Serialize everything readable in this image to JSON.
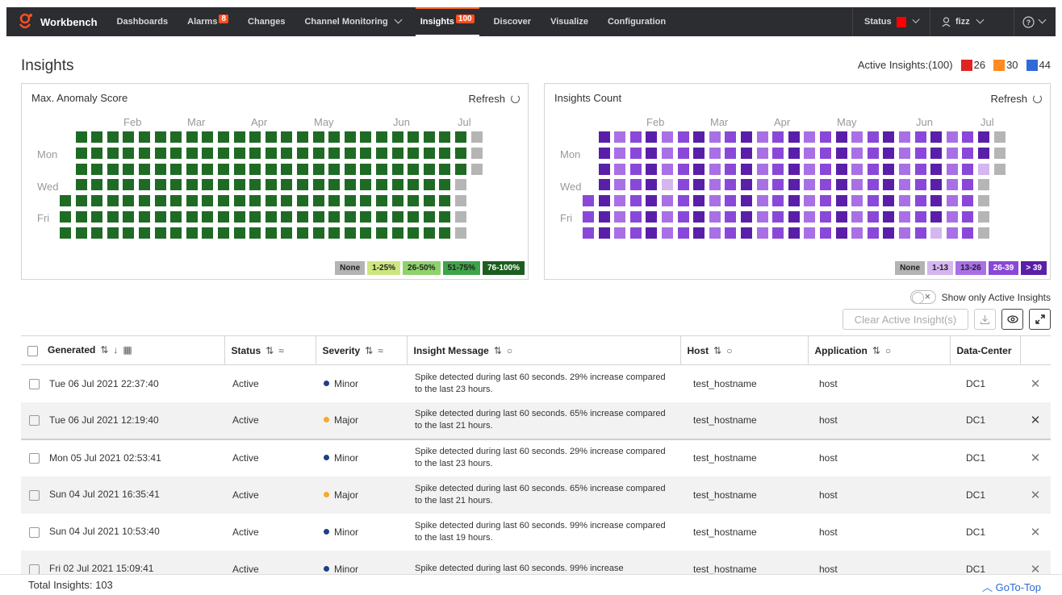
{
  "nav": {
    "brand": "Workbench",
    "items": [
      {
        "label": "Dashboards",
        "badge": "",
        "dropdown": false,
        "active": false
      },
      {
        "label": "Alarms",
        "badge": "8",
        "dropdown": false,
        "active": false
      },
      {
        "label": "Changes",
        "badge": "",
        "dropdown": false,
        "active": false
      },
      {
        "label": "Channel Monitoring",
        "badge": "",
        "dropdown": true,
        "active": false
      },
      {
        "label": "Insights",
        "badge": "100",
        "dropdown": false,
        "active": true
      },
      {
        "label": "Discover",
        "badge": "",
        "dropdown": false,
        "active": false
      },
      {
        "label": "Visualize",
        "badge": "",
        "dropdown": false,
        "active": false
      },
      {
        "label": "Configuration",
        "badge": "",
        "dropdown": false,
        "active": false
      }
    ],
    "status_label": "Status",
    "status_color": "#ff0000",
    "user": "fizz",
    "help_icon": "help-circle-icon"
  },
  "page": {
    "title": "Insights",
    "active_insights_label": "Active Insights:(100)",
    "counts": [
      {
        "value": "26",
        "color": "#e02424"
      },
      {
        "value": "30",
        "color": "#ff8a1f"
      },
      {
        "value": "44",
        "color": "#2f6bd6"
      }
    ]
  },
  "anomaly_panel": {
    "title": "Max. Anomaly Score",
    "refresh": "Refresh",
    "months": [
      "Feb",
      "Mar",
      "Apr",
      "May",
      "Jun",
      "Jul"
    ],
    "days": [
      "Mon",
      "Wed",
      "Fri"
    ],
    "legend": [
      {
        "label": "None",
        "bg": "#b3b3b3"
      },
      {
        "label": "1-25%",
        "bg": "#cde680"
      },
      {
        "label": "26-50%",
        "bg": "#8fd16b"
      },
      {
        "label": "51-75%",
        "bg": "#3fa34a"
      },
      {
        "label": "76-100%",
        "bg": "#1c5e20"
      }
    ],
    "cell_color": "#1f6b25",
    "none_color": "#b5b5b5"
  },
  "count_panel": {
    "title": "Insights Count",
    "refresh": "Refresh",
    "months": [
      "Feb",
      "Mar",
      "Apr",
      "May",
      "Jun",
      "Jul"
    ],
    "days": [
      "Mon",
      "Wed",
      "Fri"
    ],
    "legend": [
      {
        "label": "None",
        "bg": "#b3b3b3"
      },
      {
        "label": "1-13",
        "bg": "#d5b6ef"
      },
      {
        "label": "13-26",
        "bg": "#a970e6"
      },
      {
        "label": "26-39",
        "bg": "#8a48d8"
      },
      {
        "label": "> 39",
        "bg": "#5a1fa8"
      }
    ]
  },
  "controls": {
    "toggle_label": "Show only Active Insights",
    "clear_button": "Clear Active Insight(s)"
  },
  "table": {
    "columns": [
      "Generated",
      "Status",
      "Severity",
      "Insight Message",
      "Host",
      "Application",
      "Data-Center"
    ],
    "rows": [
      {
        "generated": "Tue 06 Jul 2021 22:37:40",
        "status": "Active",
        "severity": "Minor",
        "severity_color": "#1f3f8a",
        "message": "Spike detected during last 60 seconds. 29% increase compared to the last 23 hours.",
        "host": "test_hostname",
        "application": "host",
        "dc": "DC1"
      },
      {
        "generated": "Tue 06 Jul 2021 12:19:40",
        "status": "Active",
        "severity": "Major",
        "severity_color": "#f7a928",
        "message": "Spike detected during last 60 seconds. 65% increase compared to the last 21 hours.",
        "host": "test_hostname",
        "application": "host",
        "dc": "DC1"
      },
      {
        "generated": "Mon 05 Jul 2021 02:53:41",
        "status": "Active",
        "severity": "Minor",
        "severity_color": "#1f3f8a",
        "message": "Spike detected during last 60 seconds. 29% increase compared to the last 23 hours.",
        "host": "test_hostname",
        "application": "host",
        "dc": "DC1"
      },
      {
        "generated": "Sun 04 Jul 2021 16:35:41",
        "status": "Active",
        "severity": "Major",
        "severity_color": "#f7a928",
        "message": "Spike detected during last 60 seconds. 65% increase compared to the last 21 hours.",
        "host": "test_hostname",
        "application": "host",
        "dc": "DC1"
      },
      {
        "generated": "Sun 04 Jul 2021 10:53:40",
        "status": "Active",
        "severity": "Minor",
        "severity_color": "#1f3f8a",
        "message": "Spike detected during last 60 seconds. 99% increase compared to the last 19 hours.",
        "host": "test_hostname",
        "application": "host",
        "dc": "DC1"
      },
      {
        "generated": "Fri 02 Jul 2021 15:09:41",
        "status": "Active",
        "severity": "Minor",
        "severity_color": "#1f3f8a",
        "message": "Spike detected during last 60 seconds. 99% increase",
        "host": "test_hostname",
        "application": "host",
        "dc": "DC1"
      }
    ]
  },
  "footer": {
    "total": "Total Insights: 103",
    "goto": "GoTo-Top"
  }
}
